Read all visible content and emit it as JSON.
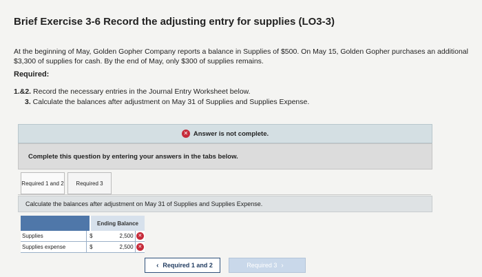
{
  "header": {
    "title": "Brief Exercise 3-6 Record the adjusting entry for supplies (LO3-3)"
  },
  "problem": {
    "text": "At the beginning of May, Golden Gopher Company reports a balance in Supplies of $500. On May 15, Golden Gopher purchases an additional $3,300 of supplies for cash. By the end of May, only $300 of supplies remains.",
    "required_label": "Required:",
    "instr1_num": "1.&2.",
    "instr1_text": " Record the necessary entries in the Journal Entry Worksheet below.",
    "instr2_num": "3.",
    "instr2_text": " Calculate the balances after adjustment on May 31 of Supplies and Supplies Expense."
  },
  "status": {
    "answer_banner": "Answer is not complete.",
    "complete_instruction": "Complete this question by entering your answers in the tabs below."
  },
  "tabs": [
    {
      "label": "Required 1 and 2"
    },
    {
      "label": "Required 3"
    }
  ],
  "panel": {
    "instruction": "Calculate the balances after adjustment on May 31 of Supplies and Supplies Expense."
  },
  "table": {
    "header": "Ending Balance",
    "rows": [
      {
        "name": "Supplies",
        "currency": "$",
        "value": "2,500"
      },
      {
        "name": "Supplies expense",
        "currency": "$",
        "value": "2,500"
      }
    ]
  },
  "nav": {
    "prev_label": "Required 1 and 2",
    "next_label": "Required 3"
  },
  "icons": {
    "incorrect": "x-circle-icon",
    "prev": "chevron-left-icon",
    "next": "chevron-right-icon"
  },
  "colors": {
    "error": "#c62b3a",
    "table_header": "#4f77a9",
    "nav_border": "#2e4f7a"
  }
}
